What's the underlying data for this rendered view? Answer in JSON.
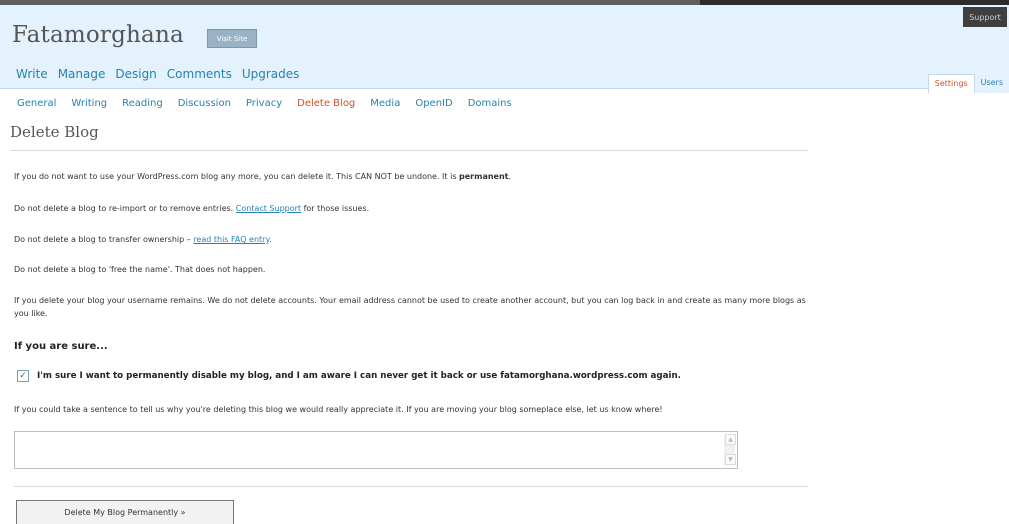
{
  "support_label": "Support",
  "site": {
    "title": "Fatamorghana",
    "visit_site_label": "Visit Site"
  },
  "main_nav": [
    "Write",
    "Manage",
    "Design",
    "Comments",
    "Upgrades"
  ],
  "right_tabs": [
    {
      "label": "Settings",
      "active": true
    },
    {
      "label": "Users",
      "active": false
    }
  ],
  "sub_nav": [
    "General",
    "Writing",
    "Reading",
    "Discussion",
    "Privacy",
    "Delete Blog",
    "Media",
    "OpenID",
    "Domains"
  ],
  "sub_nav_current": "Delete Blog",
  "page_title": "Delete Blog",
  "paragraphs": {
    "p1_text": "If you do not want to use your WordPress.com blog any more, you can delete it. This CAN NOT be undone. It is ",
    "p1_bold": "permanent",
    "p1_end": ".",
    "p2_before": "Do not delete a blog to re-import or to remove entries. ",
    "p2_link": "Contact Support",
    "p2_after": " for those issues.",
    "p3_before": "Do not delete a blog to transfer ownership – ",
    "p3_link": "read this FAQ entry",
    "p3_after": ".",
    "p4": "Do not delete a blog to 'free the name'. That does not happen.",
    "p5": "If you delete your blog your username remains. We do not delete accounts. Your email address cannot be used to create another account, but you can log back in and create as many more blogs as you like."
  },
  "sure_heading": "If you are sure...",
  "confirm": {
    "checked": true,
    "label": "I'm sure I want to permanently disable my blog, and I am aware I can never get it back or use fatamorghana.wordpress.com again."
  },
  "reason_prompt": "If you could take a sentence to tell us why you're deleting this blog we would really appreciate it. If you are moving your blog someplace else, let us know where!",
  "reason_value": "",
  "delete_button_label": "Delete My Blog Permanently »"
}
